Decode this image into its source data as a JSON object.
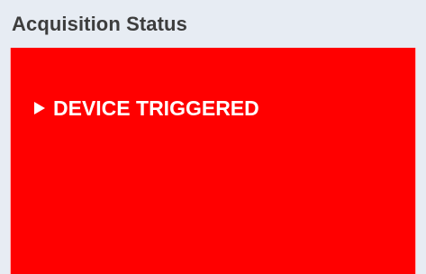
{
  "panel": {
    "title": "Acquisition Status"
  },
  "status": {
    "text": "DEVICE TRIGGERED",
    "icon": "play-arrow-icon",
    "color": "#ff0000",
    "text_color": "#ffffff"
  },
  "colors": {
    "panel_background": "#e7ecf3",
    "title_text": "#3d3d3d"
  }
}
